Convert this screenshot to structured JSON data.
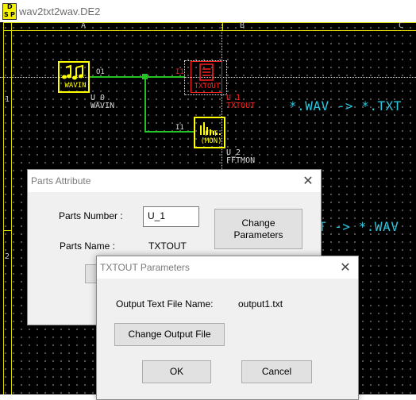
{
  "window": {
    "title": "wav2txt2wav.DE2",
    "icon_letters": [
      "D",
      "S",
      "P"
    ]
  },
  "schematic": {
    "columns": [
      "A",
      "B",
      "C"
    ],
    "rows": [
      "1",
      "2"
    ],
    "parts": [
      {
        "id": "U_0",
        "type_label": "WAVIN",
        "name": "WAVIN",
        "pin": "O1",
        "color": "#ffff00"
      },
      {
        "id": "U_1",
        "type_label": "TXTOUT",
        "name": "TXTOUT",
        "pin": "I1",
        "color": "#ff2020"
      },
      {
        "id": "U_2",
        "type_label": "FFT\n(MON)",
        "name": "FFTMON",
        "pin": "I1",
        "color": "#ffff00"
      }
    ],
    "notes": [
      "*.WAV -> *.TXT",
      "T -> *.WAV"
    ]
  },
  "parts_attribute_dialog": {
    "title": "Parts Attribute",
    "parts_number_label": "Parts Number :",
    "parts_number_value": "U_1",
    "parts_name_label": "Parts Name :",
    "parts_name_value": "TXTOUT",
    "change_parameters_label": "Change\nParameters"
  },
  "txtout_dialog": {
    "title": "TXTOUT Parameters",
    "output_file_label": "Output Text File Name:",
    "output_file_value": "output1.txt",
    "change_output_file_label": "Change Output File",
    "ok_label": "OK",
    "cancel_label": "Cancel"
  },
  "colors": {
    "canvas_bg": "#000000",
    "frame": "#dcdc00",
    "wire": "#22c322",
    "part_yellow": "#ffff00",
    "part_red": "#ff2020",
    "note": "#29c8e0"
  }
}
